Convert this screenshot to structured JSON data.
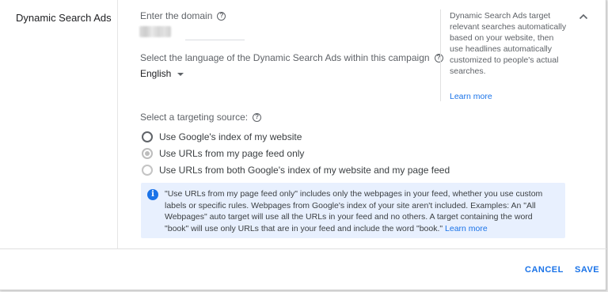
{
  "section": {
    "title": "Dynamic Search Ads"
  },
  "domain": {
    "label": "Enter the domain",
    "value_redacted": true
  },
  "language": {
    "label": "Select the language of the Dynamic Search Ads within this campaign",
    "selected": "English"
  },
  "targeting": {
    "label": "Select a targeting source:",
    "options": [
      {
        "label": "Use Google's index of my website",
        "state": "unchecked"
      },
      {
        "label": "Use URLs from my page feed only",
        "state": "checked"
      },
      {
        "label": "Use URLs from both Google's index of my website and my page feed",
        "state": "unchecked"
      }
    ]
  },
  "info": {
    "text": "\"Use URLs from my page feed only\" includes only the webpages in your feed, whether you use custom labels or specific rules. Webpages from Google's index of your site aren't included. Examples: An \"All Webpages\" auto target will use all the URLs in your feed and no others. A target containing the word \"book\" will use only URLs that are in your feed and include the word \"book.\"",
    "link": "Learn more"
  },
  "sidebar": {
    "text": "Dynamic Search Ads target relevant searches automatically based on your website, then use headlines automatically customized to people's actual searches.",
    "link": "Learn more"
  },
  "actions": {
    "cancel": "CANCEL",
    "save": "SAVE"
  },
  "colors": {
    "accent": "#1a73e8",
    "info_bg": "#e8f0fe",
    "text": "#3c4043"
  },
  "icons": {
    "help": "question-circle-icon",
    "info": "info-circle-icon",
    "collapse": "chevron-up-icon",
    "dropdown": "caret-down-icon"
  }
}
